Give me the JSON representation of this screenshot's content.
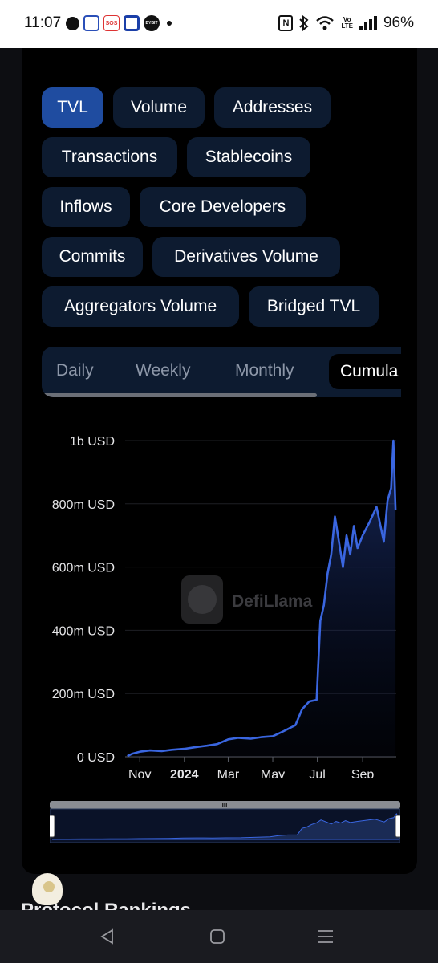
{
  "status_bar": {
    "time": "11:07",
    "battery": "96%",
    "volte": "Vo\nLTE",
    "nfc": "N",
    "sos_label": "SOS",
    "bybit_label": "BYBIT"
  },
  "metric_pills": [
    {
      "label": "TVL",
      "active": true
    },
    {
      "label": "Volume",
      "active": false
    },
    {
      "label": "Addresses",
      "active": false
    },
    {
      "label": "Transactions",
      "active": false
    },
    {
      "label": "Stablecoins",
      "active": false
    },
    {
      "label": "Inflows",
      "active": false
    },
    {
      "label": "Core Developers",
      "active": false
    },
    {
      "label": "Commits",
      "active": false
    },
    {
      "label": "Derivatives Volume",
      "active": false
    },
    {
      "label": "Aggregators Volume",
      "active": false
    },
    {
      "label": "Bridged TVL",
      "active": false
    }
  ],
  "period_tabs": [
    {
      "label": "Daily",
      "active": false
    },
    {
      "label": "Weekly",
      "active": false
    },
    {
      "label": "Monthly",
      "active": false
    },
    {
      "label": "Cumula",
      "active": true
    }
  ],
  "watermark": "DefiLlama",
  "chart_data": {
    "type": "area",
    "title": "",
    "xlabel": "",
    "ylabel": "",
    "y_ticks": [
      "0 USD",
      "200m USD",
      "400m USD",
      "600m USD",
      "800m USD",
      "1b USD"
    ],
    "ylim": [
      0,
      1000000000
    ],
    "x_ticks": [
      "Nov",
      "2024",
      "Mar",
      "May",
      "Jul",
      "Sep"
    ],
    "x": [
      "2023-10-15",
      "2023-10-22",
      "2023-11-01",
      "2023-11-15",
      "2023-12-01",
      "2023-12-15",
      "2024-01-01",
      "2024-01-15",
      "2024-02-01",
      "2024-02-15",
      "2024-03-01",
      "2024-03-15",
      "2024-04-01",
      "2024-04-15",
      "2024-05-01",
      "2024-05-15",
      "2024-06-01",
      "2024-06-10",
      "2024-06-20",
      "2024-06-30",
      "2024-07-05",
      "2024-07-10",
      "2024-07-15",
      "2024-07-20",
      "2024-07-25",
      "2024-08-01",
      "2024-08-05",
      "2024-08-10",
      "2024-08-15",
      "2024-08-20",
      "2024-08-25",
      "2024-09-01",
      "2024-09-10",
      "2024-09-20",
      "2024-09-30",
      "2024-10-05",
      "2024-10-10",
      "2024-10-13",
      "2024-10-16"
    ],
    "series": [
      {
        "color": "#3a66e0",
        "values": [
          2000000,
          10000000,
          16000000,
          20000000,
          18000000,
          22000000,
          25000000,
          30000000,
          35000000,
          40000000,
          55000000,
          60000000,
          57000000,
          62000000,
          65000000,
          80000000,
          100000000,
          150000000,
          175000000,
          180000000,
          430000000,
          480000000,
          580000000,
          640000000,
          760000000,
          660000000,
          600000000,
          700000000,
          640000000,
          730000000,
          660000000,
          700000000,
          740000000,
          790000000,
          680000000,
          810000000,
          850000000,
          1000000000,
          780000000
        ]
      }
    ],
    "grid": true,
    "legend": "none"
  },
  "brush": {
    "handle": "III"
  },
  "section_heading": "Protocol Rankings"
}
